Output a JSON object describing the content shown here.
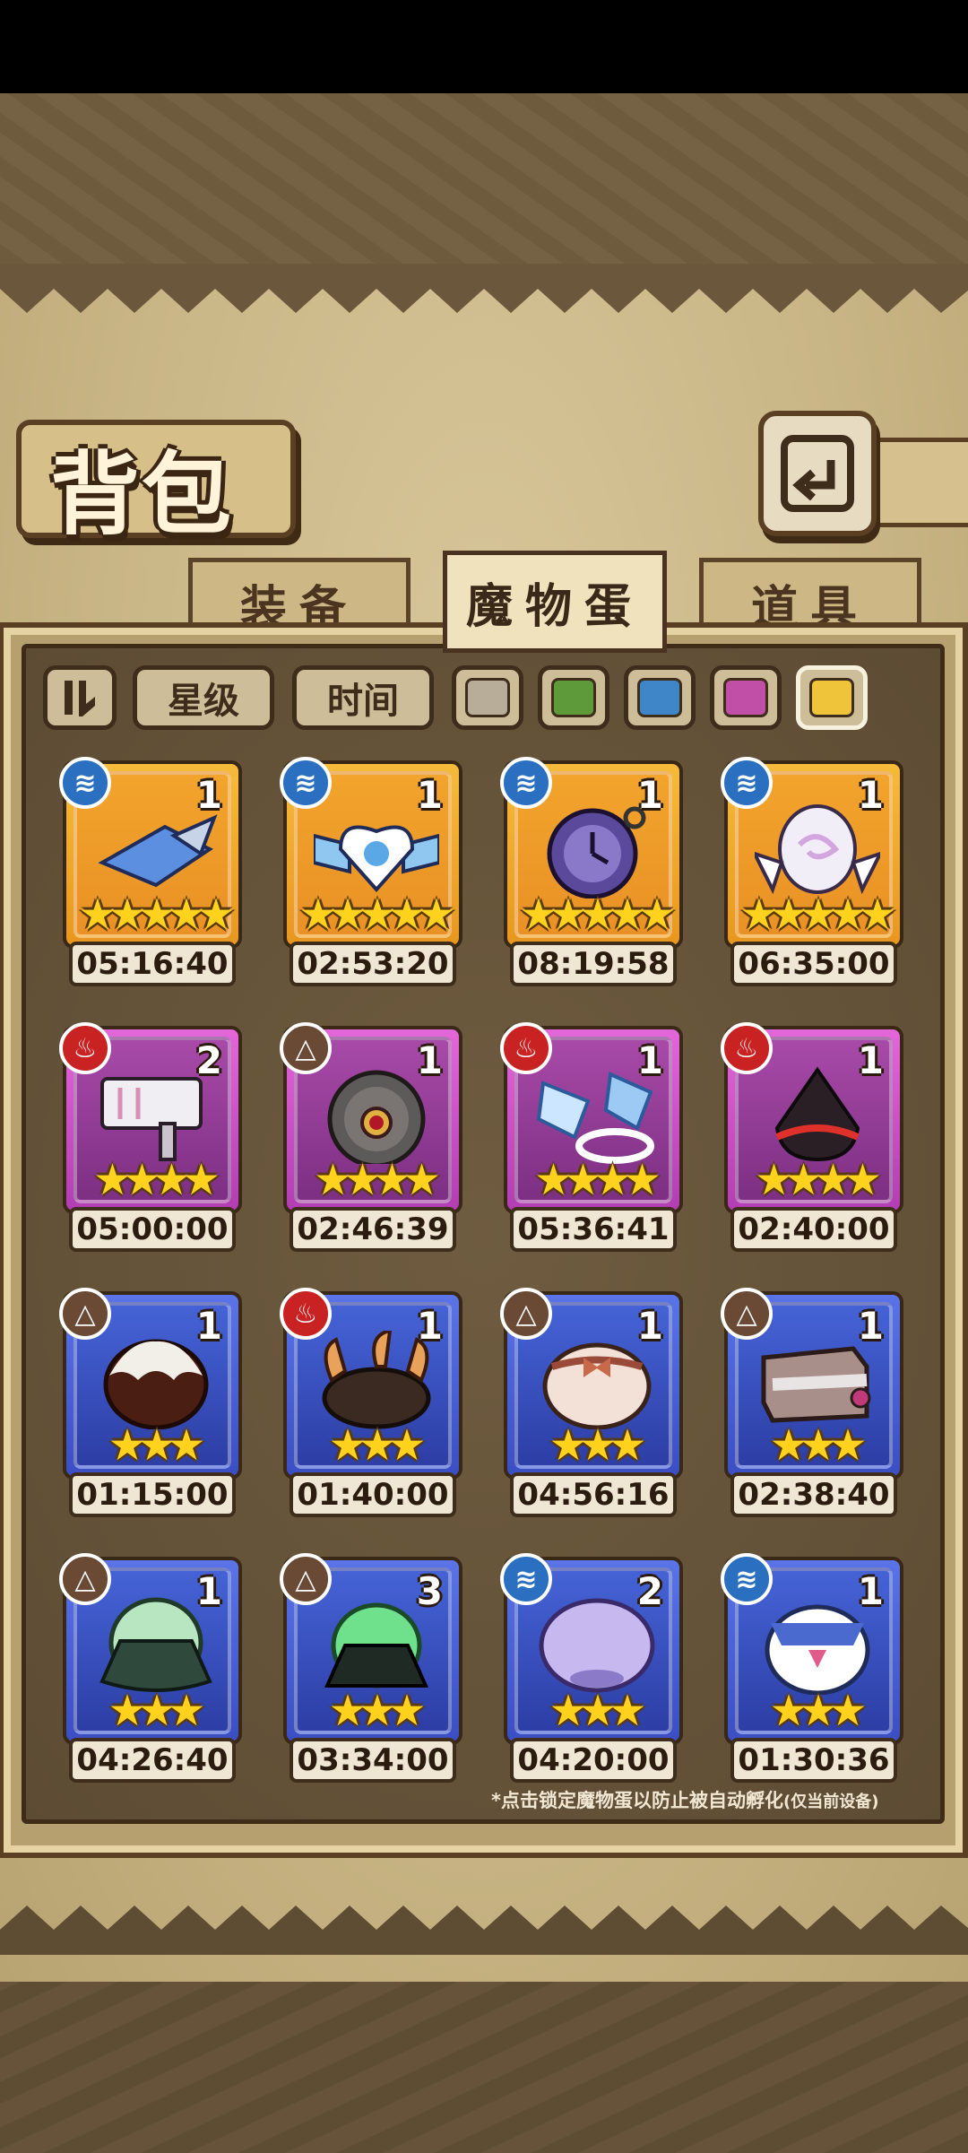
{
  "title": "背包",
  "tabs": [
    {
      "label": "装备",
      "active": false
    },
    {
      "label": "魔物蛋",
      "active": true
    },
    {
      "label": "道具",
      "active": false
    }
  ],
  "filters": {
    "sort_icon": "sort-order-icon",
    "star_label": "星级",
    "time_label": "时间",
    "rarity_colors": [
      "#b7ad98",
      "#5f9a3a",
      "#3f86c8",
      "#c24fa7",
      "#f0c43a"
    ]
  },
  "eggs": [
    {
      "element": "water",
      "count": "1",
      "stars": 5,
      "rarity": "gold",
      "timer": "05:16:40",
      "art": "blue-wing-blade"
    },
    {
      "element": "water",
      "count": "1",
      "stars": 5,
      "rarity": "gold",
      "timer": "02:53:20",
      "art": "winged-heart-crest"
    },
    {
      "element": "water",
      "count": "1",
      "stars": 5,
      "rarity": "gold",
      "timer": "08:19:58",
      "art": "pocket-watch"
    },
    {
      "element": "water",
      "count": "1",
      "stars": 5,
      "rarity": "gold",
      "timer": "06:35:00",
      "art": "winged-swirl-egg"
    },
    {
      "element": "fire",
      "count": "2",
      "stars": 4,
      "rarity": "purple",
      "timer": "05:00:00",
      "art": "white-hammer"
    },
    {
      "element": "earth",
      "count": "1",
      "stars": 4,
      "rarity": "purple",
      "timer": "02:46:39",
      "art": "stone-gear-eye"
    },
    {
      "element": "fire",
      "count": "1",
      "stars": 4,
      "rarity": "purple",
      "timer": "05:36:41",
      "art": "crystal-flags"
    },
    {
      "element": "fire",
      "count": "1",
      "stars": 4,
      "rarity": "purple",
      "timer": "02:40:00",
      "art": "dark-ember-egg"
    },
    {
      "element": "earth",
      "count": "1",
      "stars": 3,
      "rarity": "blue",
      "timer": "01:15:00",
      "art": "chocolate-egg"
    },
    {
      "element": "fire",
      "count": "1",
      "stars": 3,
      "rarity": "blue",
      "timer": "01:40:00",
      "art": "horned-bush"
    },
    {
      "element": "earth",
      "count": "1",
      "stars": 3,
      "rarity": "blue",
      "timer": "04:56:16",
      "art": "ribbon-bun"
    },
    {
      "element": "earth",
      "count": "1",
      "stars": 3,
      "rarity": "blue",
      "timer": "02:38:40",
      "art": "closed-book"
    },
    {
      "element": "earth",
      "count": "1",
      "stars": 3,
      "rarity": "blue",
      "timer": "04:26:40",
      "art": "cloaked-slime"
    },
    {
      "element": "earth",
      "count": "3",
      "stars": 3,
      "rarity": "blue",
      "timer": "03:34:00",
      "art": "green-slime"
    },
    {
      "element": "water",
      "count": "2",
      "stars": 3,
      "rarity": "blue",
      "timer": "04:20:00",
      "art": "purple-jelly"
    },
    {
      "element": "water",
      "count": "1",
      "stars": 3,
      "rarity": "blue",
      "timer": "01:30:36",
      "art": "sailor-egg"
    }
  ],
  "note": "*点击锁定魔物蛋以防止被自动孵化",
  "note_suffix": "(仅当前设备)"
}
